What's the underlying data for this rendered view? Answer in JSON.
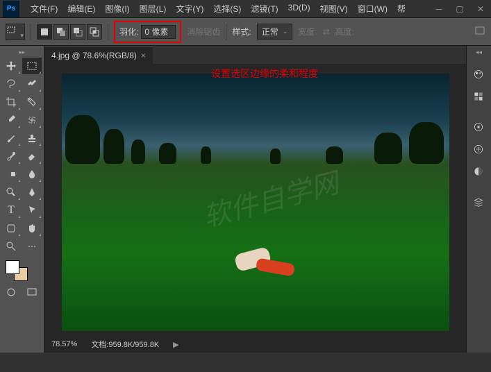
{
  "app": {
    "logo": "Ps"
  },
  "menu": {
    "file": "文件(F)",
    "edit": "编辑(E)",
    "image": "图像(I)",
    "layer": "图层(L)",
    "type": "文字(Y)",
    "select": "选择(S)",
    "filter": "滤镜(T)",
    "threed": "3D(D)",
    "view": "视图(V)",
    "window": "窗口(W)",
    "help": "帮"
  },
  "options": {
    "feather_label": "羽化:",
    "feather_value": "0 像素",
    "antialias": "消除锯齿",
    "style_label": "样式:",
    "style_value": "正常",
    "width_label": "宽度:",
    "height_label": "高度:"
  },
  "annotation": "设置选区边缘的柔和程度",
  "doc": {
    "tab": "4.jpg @ 78.6%(RGB/8)",
    "zoom": "78.57%",
    "info_label": "文档:",
    "info_value": "959.8K/959.8K"
  }
}
